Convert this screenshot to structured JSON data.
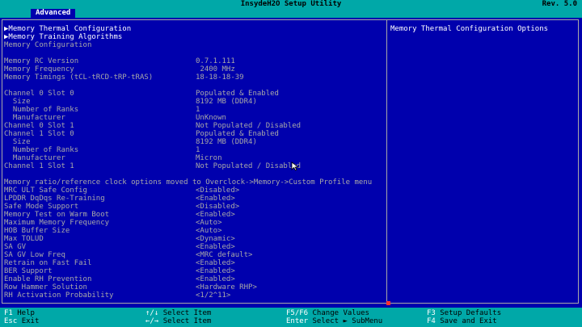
{
  "header": {
    "title": "InsydeH2O Setup Utility",
    "revision": "Rev. 5.0"
  },
  "tabs": [
    {
      "label": "Advanced",
      "active": true
    }
  ],
  "menu": {
    "items": [
      {
        "label": "Memory Thermal Configuration"
      },
      {
        "label": "Memory Training Algorithms"
      }
    ],
    "section_title": "Memory Configuration"
  },
  "info": [
    {
      "label": "Memory RC Version",
      "value": "0.7.1.111"
    },
    {
      "label": "Memory Frequency",
      "value": " 2400 MHz"
    },
    {
      "label": "Memory Timings (tCL-tRCD-tRP-tRAS)",
      "value": "18-18-18-39"
    }
  ],
  "slots": [
    {
      "label": "Channel 0 Slot 0",
      "value": "Populated & Enabled"
    },
    {
      "label": "  Size",
      "value": "8192 MB (DDR4)"
    },
    {
      "label": "  Number of Ranks",
      "value": "1"
    },
    {
      "label": "  Manufacturer",
      "value": "UnKnown"
    },
    {
      "label": "Channel 0 Slot 1",
      "value": "Not Populated / Disabled"
    },
    {
      "label": "Channel 1 Slot 0",
      "value": "Populated & Enabled"
    },
    {
      "label": "  Size",
      "value": "8192 MB (DDR4)"
    },
    {
      "label": "  Number of Ranks",
      "value": "1"
    },
    {
      "label": "  Manufacturer",
      "value": "Micron"
    },
    {
      "label": "Channel 1 Slot 1",
      "value": "Not Populated / Disabled"
    }
  ],
  "note": "Memory ratio/reference clock options moved to Overclock->Memory->Custom Profile menu",
  "settings": [
    {
      "label": "MRC ULT Safe Config",
      "value": "<Disabled>"
    },
    {
      "label": "LPDDR DqDqs Re-Training",
      "value": "<Enabled>"
    },
    {
      "label": "Safe Mode Support",
      "value": "<Disabled>"
    },
    {
      "label": "Memory Test on Warm Boot",
      "value": "<Enabled>"
    },
    {
      "label": "Maximum Memory Frequency",
      "value": "<Auto>"
    },
    {
      "label": "HOB Buffer Size",
      "value": "<Auto>"
    },
    {
      "label": "Max TOLUD",
      "value": "<Dynamic>"
    },
    {
      "label": "SA GV",
      "value": "<Enabled>"
    },
    {
      "label": "SA GV Low Freq",
      "value": "<MRC default>"
    },
    {
      "label": "Retrain on Fast Fail",
      "value": "<Enabled>"
    },
    {
      "label": "BER Support",
      "value": "<Enabled>"
    },
    {
      "label": "Enable RH Prevention",
      "value": "<Enabled>"
    },
    {
      "label": "Row Hammer Solution",
      "value": "<Hardware RHP>"
    },
    {
      "label": "RH Activation Probability",
      "value": "<1/2^11>"
    }
  ],
  "help": {
    "text": "Memory Thermal Configuration Options"
  },
  "footer": [
    {
      "key": "F1",
      "desc": "Help"
    },
    {
      "key": "Esc",
      "desc": "Exit"
    },
    {
      "key": "↑/↓",
      "desc": "Select Item"
    },
    {
      "key": "←/→",
      "desc": "Select Item"
    },
    {
      "key": "F5/F6",
      "desc": "Change Values"
    },
    {
      "key": "Enter",
      "desc": "Select ► SubMenu"
    },
    {
      "key": "F3",
      "desc": "Setup Defaults"
    },
    {
      "key": "F4",
      "desc": "Save and Exit"
    }
  ],
  "colors": {
    "background": "#0000ad",
    "accent": "#00a8a8",
    "text": "#a8a8a8",
    "highlight": "#ffffff"
  },
  "icons": {
    "submenu_marker": "triangle-right-icon",
    "mouse_cursor": "cursor-arrow-icon"
  }
}
